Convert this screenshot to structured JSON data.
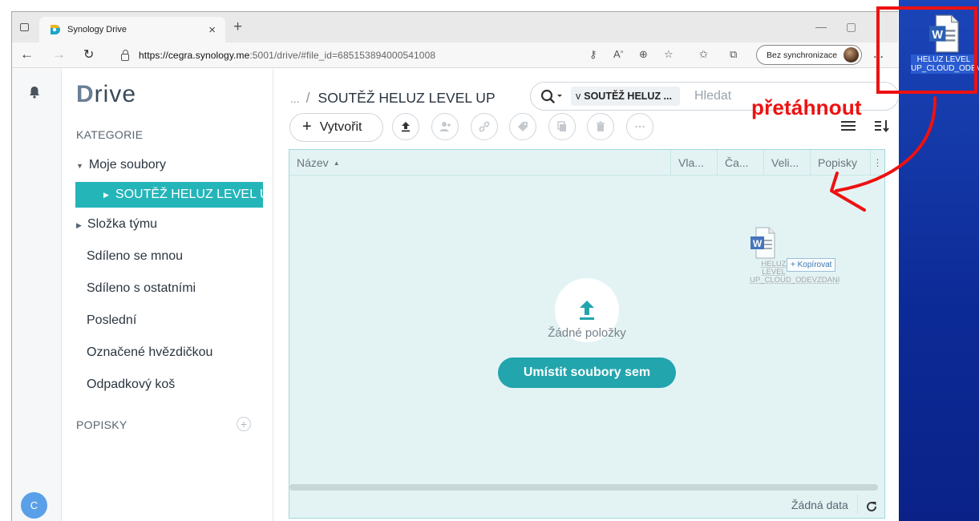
{
  "browser": {
    "tab_title": "Synology Drive",
    "tab_close": "×",
    "new_tab": "+",
    "url_host": "https://cegra.synology.me",
    "url_path": ":5001/drive/#file_id=685153894000541008",
    "sync_label": "Bez synchronizace",
    "minimize": "—",
    "maximize": "▢",
    "close": "✕"
  },
  "app": {
    "logo_d": "D",
    "logo_rest": "rive",
    "user_initial": "C"
  },
  "sidebar": {
    "categories_label": "KATEGORIE",
    "my_files": "Moje soubory",
    "active_folder": "SOUTĚŽ HELUZ LEVEL UP",
    "team_folder": "Složka týmu",
    "items": [
      "Sdíleno se mnou",
      "Sdíleno s ostatními",
      "Poslední",
      "Označené hvězdičkou",
      "Odpadkový koš"
    ],
    "labels_section": "POPISKY",
    "add_label": "+"
  },
  "main": {
    "breadcrumb_dots": "...",
    "breadcrumb_sep": "/",
    "breadcrumb_current": "SOUTĚŽ HELUZ LEVEL UP",
    "search_scope_prefix": "v",
    "search_scope_name": "SOUTĚŽ HELUZ ...",
    "search_placeholder": "Hledat",
    "create_label": "Vytvořit",
    "create_plus": "+",
    "columns": {
      "name": "Název",
      "owner": "Vla...",
      "time": "Ča...",
      "size": "Veli...",
      "labels": "Popisky",
      "more": "⋮"
    },
    "empty_text": "Žádné položky",
    "drop_button": "Umístit soubory sem",
    "footer_status": "Žádná data"
  },
  "drag": {
    "ghost_label": "HELUZ LEVEL UP_CLOUD_ODEVZDANI",
    "copy_tooltip": "+ Kopírovat"
  },
  "desktop": {
    "file_label": "HELUZ LEVEL UP_CLOUD_ODEVZDANI"
  },
  "annotation": {
    "text": "přetáhnout",
    "color": "#ee1111"
  },
  "colors": {
    "accent": "#24b5b9",
    "drop_button": "#22a5ad",
    "word_blue": "#2b5fb4"
  }
}
